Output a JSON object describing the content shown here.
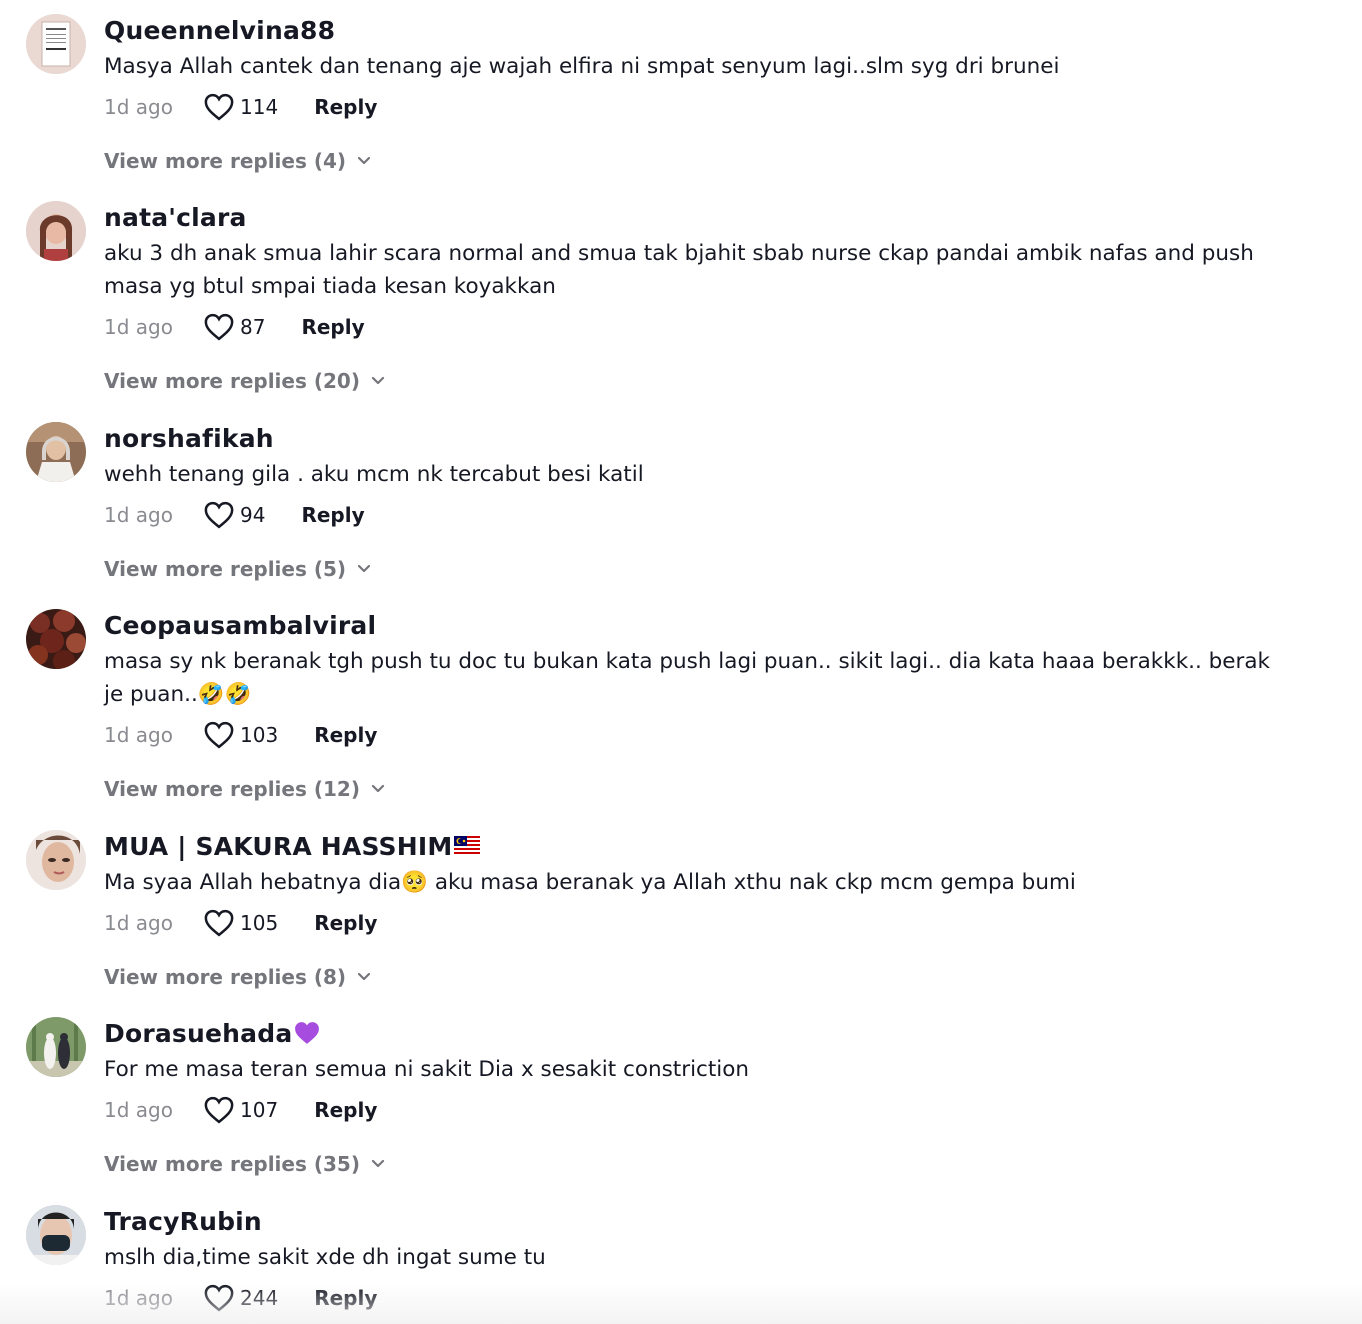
{
  "comments": [
    {
      "username": "Queennelvina88",
      "username_suffix": "",
      "text": "Masya Allah cantek dan tenang aje wajah elfira ni smpat senyum lagi..slm syg dri brunei",
      "time": "1d ago",
      "likes": "114",
      "reply_label": "Reply",
      "view_more": "View more replies (4)",
      "avatar_color": "#e9d7cf"
    },
    {
      "username": "nata'clara",
      "username_suffix": "",
      "text": "aku 3 dh anak smua lahir scara normal and smua tak bjahit sbab nurse ckap pandai ambik nafas and push masa yg btul smpai tiada kesan koyakkan",
      "time": "1d ago",
      "likes": "87",
      "reply_label": "Reply",
      "view_more": "View more replies (20)",
      "avatar_color": "#c98a7a"
    },
    {
      "username": "norshafikah",
      "username_suffix": "",
      "text": "wehh tenang gila . aku mcm nk tercabut besi katil",
      "time": "1d ago",
      "likes": "94",
      "reply_label": "Reply",
      "view_more": "View more replies (5)",
      "avatar_color": "#b9a38c"
    },
    {
      "username": "Ceopausambalviral",
      "username_suffix": "",
      "text": "masa sy nk beranak tgh push tu doc tu bukan kata push lagi puan.. sikit lagi.. dia kata haaa berakkk.. berak je puan..🤣🤣",
      "time": "1d ago",
      "likes": "103",
      "reply_label": "Reply",
      "view_more": "View more replies (12)",
      "avatar_color": "#5a2a22"
    },
    {
      "username": "MUA | SAKURA HASSHIM",
      "username_suffix": "🇲🇾",
      "text": "Ma syaa Allah hebatnya dia🥺 aku masa beranak ya Allah xthu nak ckp mcm gempa bumi",
      "time": "1d ago",
      "likes": "105",
      "reply_label": "Reply",
      "view_more": "View more replies (8)",
      "avatar_color": "#d8b6a3"
    },
    {
      "username": "Dorasuehada",
      "username_suffix": "💜",
      "text": "For me masa teran semua ni sakit Dia x sesakit constriction",
      "time": "1d ago",
      "likes": "107",
      "reply_label": "Reply",
      "view_more": "View more replies (35)",
      "avatar_color": "#8aa679"
    },
    {
      "username": "TracyRubin",
      "username_suffix": "",
      "text": "mslh dia,time sakit xde dh ingat sume tu",
      "time": "1d ago",
      "likes": "244",
      "reply_label": "Reply",
      "view_more": "",
      "avatar_color": "#cfd6dc"
    }
  ]
}
